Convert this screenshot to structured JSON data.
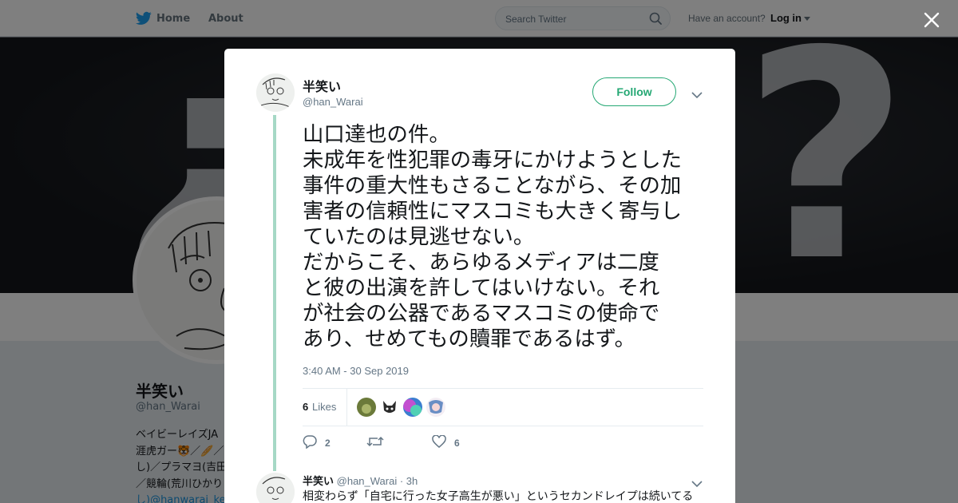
{
  "topbar": {
    "home_label": "Home",
    "about_label": "About",
    "search_placeholder": "Search Twitter",
    "account_question": "Have an account?",
    "login_label": "Log in"
  },
  "profile_bg": {
    "name": "半笑い",
    "handle": "@han_Warai",
    "bio_lines": [
      "ベイビーレイズJA",
      "涯虎ガー🐯／🥖／",
      "し)／プラマヨ(吉田",
      "／競輪(荒川ひかり",
      "し)@hanwarai_ke"
    ]
  },
  "tweet": {
    "author_name": "半笑い",
    "author_handle": "@han_Warai",
    "follow_label": "Follow",
    "text_lines": [
      "山口達也の件。",
      "未成年を性犯罪の毒牙にかけようとした",
      "事件の重大性もさることながら、その加",
      "害者の信頼性にマスコミも大きく寄与し",
      "ていたのは見逃せない。",
      "だからこそ、あらゆるメディアは二度",
      "と彼の出演を許してはいけない。それ",
      "が社会の公器であるマスコミの使命で",
      "あり、せめてもの贖罪であるはず。"
    ],
    "timestamp": "3:40 AM - 30 Sep 2019",
    "likes_count": "6",
    "likes_label": "Likes",
    "reply_count": "2",
    "retweet_count": "",
    "like_action_count": "6"
  },
  "reply": {
    "author_name": "半笑い",
    "author_handle": "@han_Warai",
    "time": "· 3h",
    "text": "相変わらず「自宅に行った女子高生が悪い」というセカンドレイプは続いてる"
  },
  "colors": {
    "accent": "#25a874",
    "thread_line": "#a6d8c5",
    "twitter_blue": "#1da1f2",
    "text_primary": "#14171a",
    "text_secondary": "#657786"
  }
}
